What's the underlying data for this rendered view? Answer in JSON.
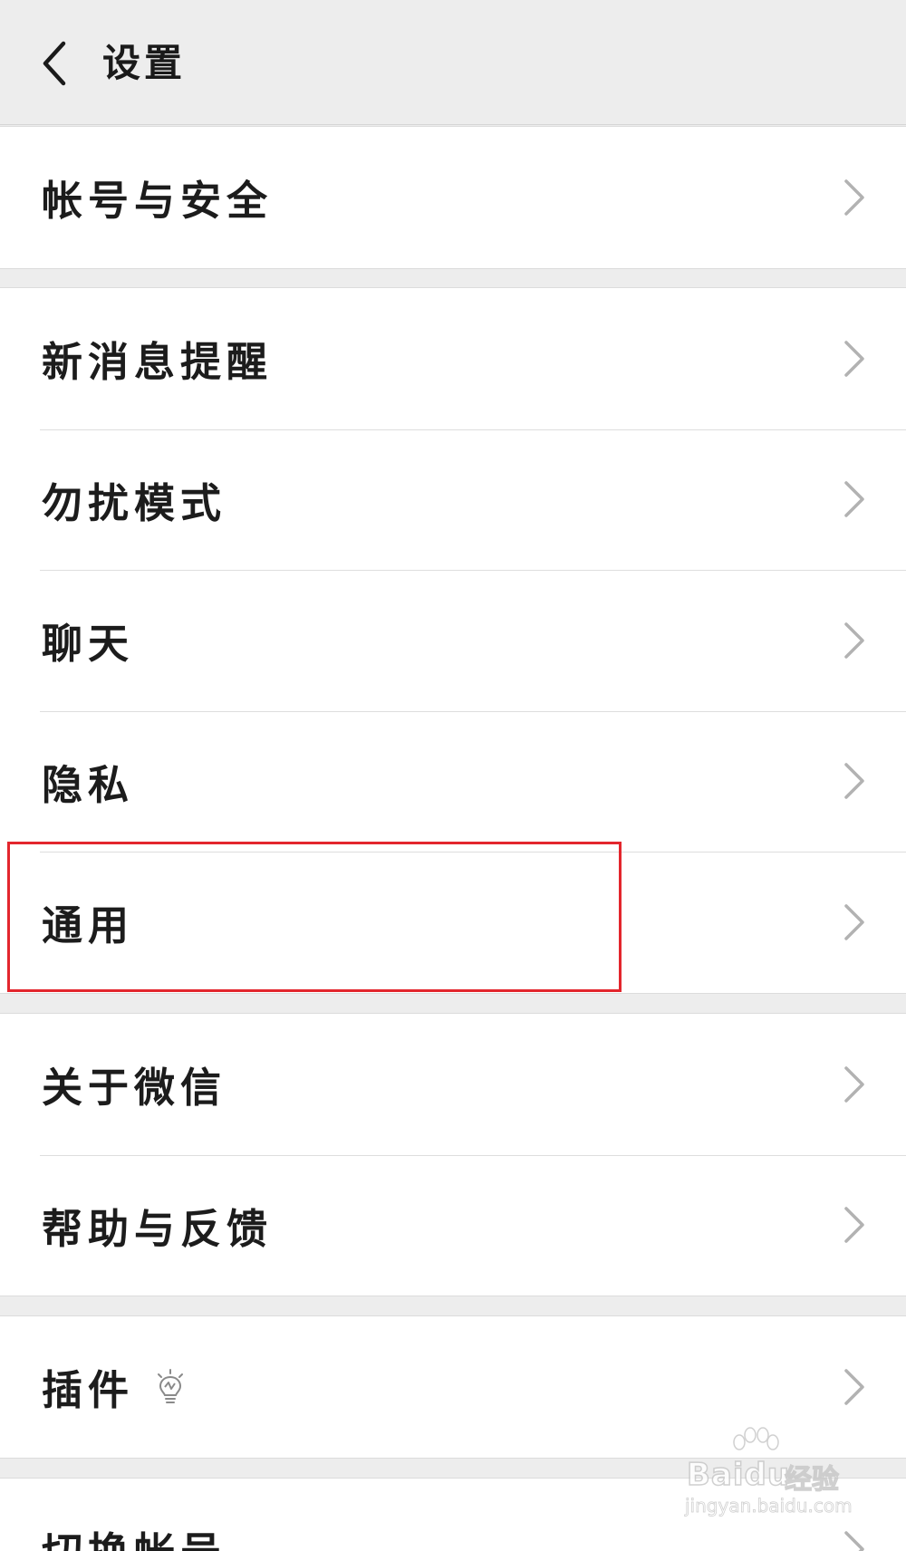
{
  "header": {
    "title": "设置"
  },
  "groups": [
    {
      "items": [
        {
          "label": "帐号与安全"
        }
      ]
    },
    {
      "items": [
        {
          "label": "新消息提醒"
        },
        {
          "label": "勿扰模式"
        },
        {
          "label": "聊天"
        },
        {
          "label": "隐私"
        },
        {
          "label": "通用"
        }
      ]
    },
    {
      "items": [
        {
          "label": "关于微信"
        },
        {
          "label": "帮助与反馈"
        }
      ]
    },
    {
      "items": [
        {
          "label": "插件"
        }
      ]
    },
    {
      "items": [
        {
          "label": "切换帐号"
        }
      ]
    }
  ],
  "watermark": {
    "brand": "Baidu",
    "product": "经验",
    "url": "jingyan.baidu.com"
  },
  "colors": {
    "background": "#ededed",
    "row_background": "#ffffff",
    "highlight": "#e3262d",
    "chevron": "#b2b2b2"
  }
}
